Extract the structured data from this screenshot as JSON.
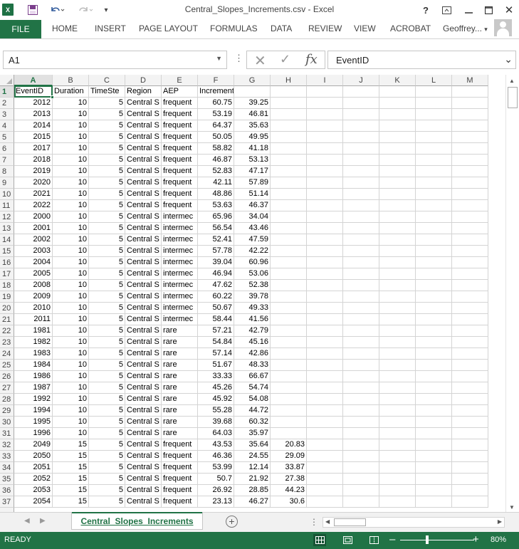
{
  "app": {
    "title": "Central_Slopes_Increments.csv - Excel",
    "brand_color": "#217346"
  },
  "quick_access": {
    "logo_text": "X",
    "save_icon": "save-icon",
    "undo_icon": "undo-icon",
    "redo_icon": "redo-icon"
  },
  "window_controls": {
    "help": "?"
  },
  "ribbon": {
    "file_tab": "FILE",
    "tabs": [
      "HOME",
      "INSERT",
      "PAGE LAYOUT",
      "FORMULAS",
      "DATA",
      "REVIEW",
      "VIEW",
      "ACROBAT"
    ],
    "user": "Geoffrey..."
  },
  "formula_bar": {
    "name_box": "A1",
    "formula": "EventID",
    "fx": "fx"
  },
  "grid": {
    "columns": [
      "A",
      "B",
      "C",
      "D",
      "E",
      "F",
      "G",
      "H",
      "I",
      "J",
      "K",
      "L",
      "M"
    ],
    "selected_column": "A",
    "selected_row": "1",
    "rows": [
      {
        "n": "1",
        "cells": [
          "EventID",
          "Duration",
          "TimeSte",
          "Region",
          "AEP",
          "Increments",
          "",
          "",
          "",
          "",
          "",
          "",
          ""
        ]
      },
      {
        "n": "2",
        "cells": [
          "2012",
          "10",
          "5",
          "Central S",
          "frequent",
          "60.75",
          "39.25",
          "",
          "",
          "",
          "",
          "",
          ""
        ]
      },
      {
        "n": "3",
        "cells": [
          "2013",
          "10",
          "5",
          "Central S",
          "frequent",
          "53.19",
          "46.81",
          "",
          "",
          "",
          "",
          "",
          ""
        ]
      },
      {
        "n": "4",
        "cells": [
          "2014",
          "10",
          "5",
          "Central S",
          "frequent",
          "64.37",
          "35.63",
          "",
          "",
          "",
          "",
          "",
          ""
        ]
      },
      {
        "n": "5",
        "cells": [
          "2015",
          "10",
          "5",
          "Central S",
          "frequent",
          "50.05",
          "49.95",
          "",
          "",
          "",
          "",
          "",
          ""
        ]
      },
      {
        "n": "6",
        "cells": [
          "2017",
          "10",
          "5",
          "Central S",
          "frequent",
          "58.82",
          "41.18",
          "",
          "",
          "",
          "",
          "",
          ""
        ]
      },
      {
        "n": "7",
        "cells": [
          "2018",
          "10",
          "5",
          "Central S",
          "frequent",
          "46.87",
          "53.13",
          "",
          "",
          "",
          "",
          "",
          ""
        ]
      },
      {
        "n": "8",
        "cells": [
          "2019",
          "10",
          "5",
          "Central S",
          "frequent",
          "52.83",
          "47.17",
          "",
          "",
          "",
          "",
          "",
          ""
        ]
      },
      {
        "n": "9",
        "cells": [
          "2020",
          "10",
          "5",
          "Central S",
          "frequent",
          "42.11",
          "57.89",
          "",
          "",
          "",
          "",
          "",
          ""
        ]
      },
      {
        "n": "10",
        "cells": [
          "2021",
          "10",
          "5",
          "Central S",
          "frequent",
          "48.86",
          "51.14",
          "",
          "",
          "",
          "",
          "",
          ""
        ]
      },
      {
        "n": "11",
        "cells": [
          "2022",
          "10",
          "5",
          "Central S",
          "frequent",
          "53.63",
          "46.37",
          "",
          "",
          "",
          "",
          "",
          ""
        ]
      },
      {
        "n": "12",
        "cells": [
          "2000",
          "10",
          "5",
          "Central S",
          "intermec",
          "65.96",
          "34.04",
          "",
          "",
          "",
          "",
          "",
          ""
        ]
      },
      {
        "n": "13",
        "cells": [
          "2001",
          "10",
          "5",
          "Central S",
          "intermec",
          "56.54",
          "43.46",
          "",
          "",
          "",
          "",
          "",
          ""
        ]
      },
      {
        "n": "14",
        "cells": [
          "2002",
          "10",
          "5",
          "Central S",
          "intermec",
          "52.41",
          "47.59",
          "",
          "",
          "",
          "",
          "",
          ""
        ]
      },
      {
        "n": "15",
        "cells": [
          "2003",
          "10",
          "5",
          "Central S",
          "intermec",
          "57.78",
          "42.22",
          "",
          "",
          "",
          "",
          "",
          ""
        ]
      },
      {
        "n": "16",
        "cells": [
          "2004",
          "10",
          "5",
          "Central S",
          "intermec",
          "39.04",
          "60.96",
          "",
          "",
          "",
          "",
          "",
          ""
        ]
      },
      {
        "n": "17",
        "cells": [
          "2005",
          "10",
          "5",
          "Central S",
          "intermec",
          "46.94",
          "53.06",
          "",
          "",
          "",
          "",
          "",
          ""
        ]
      },
      {
        "n": "18",
        "cells": [
          "2008",
          "10",
          "5",
          "Central S",
          "intermec",
          "47.62",
          "52.38",
          "",
          "",
          "",
          "",
          "",
          ""
        ]
      },
      {
        "n": "19",
        "cells": [
          "2009",
          "10",
          "5",
          "Central S",
          "intermec",
          "60.22",
          "39.78",
          "",
          "",
          "",
          "",
          "",
          ""
        ]
      },
      {
        "n": "20",
        "cells": [
          "2010",
          "10",
          "5",
          "Central S",
          "intermec",
          "50.67",
          "49.33",
          "",
          "",
          "",
          "",
          "",
          ""
        ]
      },
      {
        "n": "21",
        "cells": [
          "2011",
          "10",
          "5",
          "Central S",
          "intermec",
          "58.44",
          "41.56",
          "",
          "",
          "",
          "",
          "",
          ""
        ]
      },
      {
        "n": "22",
        "cells": [
          "1981",
          "10",
          "5",
          "Central S",
          "rare",
          "57.21",
          "42.79",
          "",
          "",
          "",
          "",
          "",
          ""
        ]
      },
      {
        "n": "23",
        "cells": [
          "1982",
          "10",
          "5",
          "Central S",
          "rare",
          "54.84",
          "45.16",
          "",
          "",
          "",
          "",
          "",
          ""
        ]
      },
      {
        "n": "24",
        "cells": [
          "1983",
          "10",
          "5",
          "Central S",
          "rare",
          "57.14",
          "42.86",
          "",
          "",
          "",
          "",
          "",
          ""
        ]
      },
      {
        "n": "25",
        "cells": [
          "1984",
          "10",
          "5",
          "Central S",
          "rare",
          "51.67",
          "48.33",
          "",
          "",
          "",
          "",
          "",
          ""
        ]
      },
      {
        "n": "26",
        "cells": [
          "1986",
          "10",
          "5",
          "Central S",
          "rare",
          "33.33",
          "66.67",
          "",
          "",
          "",
          "",
          "",
          ""
        ]
      },
      {
        "n": "27",
        "cells": [
          "1987",
          "10",
          "5",
          "Central S",
          "rare",
          "45.26",
          "54.74",
          "",
          "",
          "",
          "",
          "",
          ""
        ]
      },
      {
        "n": "28",
        "cells": [
          "1992",
          "10",
          "5",
          "Central S",
          "rare",
          "45.92",
          "54.08",
          "",
          "",
          "",
          "",
          "",
          ""
        ]
      },
      {
        "n": "29",
        "cells": [
          "1994",
          "10",
          "5",
          "Central S",
          "rare",
          "55.28",
          "44.72",
          "",
          "",
          "",
          "",
          "",
          ""
        ]
      },
      {
        "n": "30",
        "cells": [
          "1995",
          "10",
          "5",
          "Central S",
          "rare",
          "39.68",
          "60.32",
          "",
          "",
          "",
          "",
          "",
          ""
        ]
      },
      {
        "n": "31",
        "cells": [
          "1996",
          "10",
          "5",
          "Central S",
          "rare",
          "64.03",
          "35.97",
          "",
          "",
          "",
          "",
          "",
          ""
        ]
      },
      {
        "n": "32",
        "cells": [
          "2049",
          "15",
          "5",
          "Central S",
          "frequent",
          "43.53",
          "35.64",
          "20.83",
          "",
          "",
          "",
          "",
          ""
        ]
      },
      {
        "n": "33",
        "cells": [
          "2050",
          "15",
          "5",
          "Central S",
          "frequent",
          "46.36",
          "24.55",
          "29.09",
          "",
          "",
          "",
          "",
          ""
        ]
      },
      {
        "n": "34",
        "cells": [
          "2051",
          "15",
          "5",
          "Central S",
          "frequent",
          "53.99",
          "12.14",
          "33.87",
          "",
          "",
          "",
          "",
          ""
        ]
      },
      {
        "n": "35",
        "cells": [
          "2052",
          "15",
          "5",
          "Central S",
          "frequent",
          "50.7",
          "21.92",
          "27.38",
          "",
          "",
          "",
          "",
          ""
        ]
      },
      {
        "n": "36",
        "cells": [
          "2053",
          "15",
          "5",
          "Central S",
          "frequent",
          "26.92",
          "28.85",
          "44.23",
          "",
          "",
          "",
          "",
          ""
        ]
      },
      {
        "n": "37",
        "cells": [
          "2054",
          "15",
          "5",
          "Central S",
          "frequent",
          "23.13",
          "46.27",
          "30.6",
          "",
          "",
          "",
          "",
          ""
        ]
      }
    ]
  },
  "sheets": {
    "tabs": [
      "Central_Slopes_Increments"
    ],
    "add_label": "+"
  },
  "status": {
    "text": "READY",
    "zoom": "80%"
  }
}
